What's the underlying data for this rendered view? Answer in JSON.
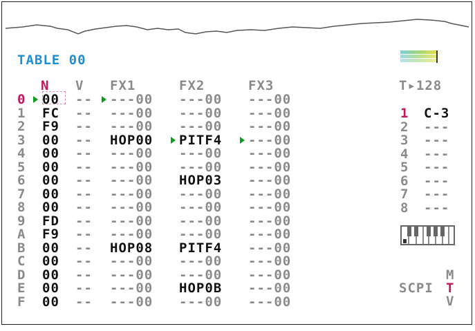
{
  "table": {
    "title": "TABLE 00"
  },
  "headers": {
    "n": "N",
    "v": "V",
    "fx1": "FX1",
    "fx2": "FX2",
    "fx3": "FX3"
  },
  "tempo": {
    "label": "T▸128"
  },
  "rows": [
    {
      "idx": "0",
      "n": "00",
      "v": "--",
      "fx1": "---00",
      "fx2": "---00",
      "fx3": "---00"
    },
    {
      "idx": "1",
      "n": "FC",
      "v": "--",
      "fx1": "---00",
      "fx2": "---00",
      "fx3": "---00"
    },
    {
      "idx": "2",
      "n": "F9",
      "v": "--",
      "fx1": "---00",
      "fx2": "---00",
      "fx3": "---00"
    },
    {
      "idx": "3",
      "n": "00",
      "v": "--",
      "fx1": "HOP00",
      "fx2": "PITF4",
      "fx3": "---00"
    },
    {
      "idx": "4",
      "n": "00",
      "v": "--",
      "fx1": "---00",
      "fx2": "---00",
      "fx3": "---00"
    },
    {
      "idx": "5",
      "n": "00",
      "v": "--",
      "fx1": "---00",
      "fx2": "---00",
      "fx3": "---00"
    },
    {
      "idx": "6",
      "n": "00",
      "v": "--",
      "fx1": "---00",
      "fx2": "HOP03",
      "fx3": "---00"
    },
    {
      "idx": "7",
      "n": "00",
      "v": "--",
      "fx1": "---00",
      "fx2": "---00",
      "fx3": "---00"
    },
    {
      "idx": "8",
      "n": "00",
      "v": "--",
      "fx1": "---00",
      "fx2": "---00",
      "fx3": "---00"
    },
    {
      "idx": "9",
      "n": "FD",
      "v": "--",
      "fx1": "---00",
      "fx2": "---00",
      "fx3": "---00"
    },
    {
      "idx": "A",
      "n": "F9",
      "v": "--",
      "fx1": "---00",
      "fx2": "---00",
      "fx3": "---00"
    },
    {
      "idx": "B",
      "n": "00",
      "v": "--",
      "fx1": "HOP08",
      "fx2": "PITF4",
      "fx3": "---00"
    },
    {
      "idx": "C",
      "n": "00",
      "v": "--",
      "fx1": "---00",
      "fx2": "---00",
      "fx3": "---00"
    },
    {
      "idx": "D",
      "n": "00",
      "v": "--",
      "fx1": "---00",
      "fx2": "---00",
      "fx3": "---00"
    },
    {
      "idx": "E",
      "n": "00",
      "v": "--",
      "fx1": "---00",
      "fx2": "HOP0B",
      "fx3": "---00"
    },
    {
      "idx": "F",
      "n": "00",
      "v": "--",
      "fx1": "---00",
      "fx2": "---00",
      "fx3": "---00"
    }
  ],
  "channels": [
    {
      "idx": "1",
      "note": "C-3"
    },
    {
      "idx": "2",
      "note": "---"
    },
    {
      "idx": "3",
      "note": "---"
    },
    {
      "idx": "4",
      "note": "---"
    },
    {
      "idx": "5",
      "note": "---"
    },
    {
      "idx": "6",
      "note": "---"
    },
    {
      "idx": "7",
      "note": "---"
    },
    {
      "idx": "8",
      "note": "---"
    }
  ],
  "screen_map": {
    "top": "M",
    "left": "SCPI",
    "current": "T",
    "bottom": "V"
  },
  "colors": {
    "pink": "#c2185b",
    "blue": "#1e8fd6",
    "green": "#0a9c1a",
    "gray": "#8a8a8a",
    "black": "#111111"
  }
}
